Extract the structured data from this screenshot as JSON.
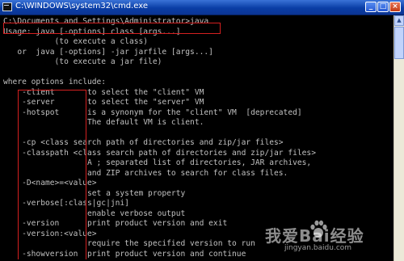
{
  "window": {
    "title": "C:\\WINDOWS\\system32\\cmd.exe",
    "buttons": {
      "minimize": "_",
      "maximize": "□",
      "close": "×"
    },
    "colors": {
      "titlebar": "#0a3ea6",
      "console_bg": "#000000",
      "console_text": "#c0c0c0",
      "highlight": "#d42020"
    }
  },
  "console": {
    "lines": [
      "C:\\Documents and Settings\\Administrator>java",
      "Usage: java [-options] class [args...]",
      "           (to execute a class)",
      "   or  java [-options] -jar jarfile [args...]",
      "           (to execute a jar file)",
      "",
      "where options include:",
      "    -client       to select the \"client\" VM",
      "    -server       to select the \"server\" VM",
      "    -hotspot      is a synonym for the \"client\" VM  [deprecated]",
      "                  The default VM is client.",
      "",
      "    -cp <class search path of directories and zip/jar files>",
      "    -classpath <class search path of directories and zip/jar files>",
      "                  A ; separated list of directories, JAR archives,",
      "                  and ZIP archives to search for class files.",
      "    -D<name>=<value>",
      "                  set a system property",
      "    -verbose[:class|gc|jni]",
      "                  enable verbose output",
      "    -version      print product version and exit",
      "    -version:<value>",
      "                  require the specified version to run",
      "    -showversion  print product version and continue"
    ]
  },
  "watermark": {
    "main": "我爱Bai经验",
    "sub": "jingyan.baidu.com"
  }
}
